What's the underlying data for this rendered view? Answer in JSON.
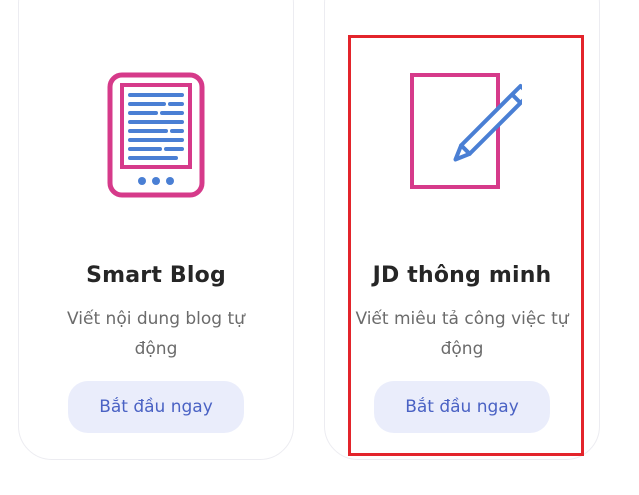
{
  "colors": {
    "icon_magenta": "#d63a8a",
    "icon_blue": "#4a7fd4",
    "button_bg": "#eaedfb",
    "button_text": "#4a62c4",
    "highlight": "#e3242b"
  },
  "cards": [
    {
      "icon": "ebook-reader-icon",
      "title": "Smart Blog",
      "description": "Viết nội dung blog tự động",
      "button_label": "Bắt đầu ngay"
    },
    {
      "icon": "document-pen-icon",
      "title": "JD thông minh",
      "description": "Viết miêu tả công việc tự động",
      "button_label": "Bắt đầu ngay"
    }
  ]
}
